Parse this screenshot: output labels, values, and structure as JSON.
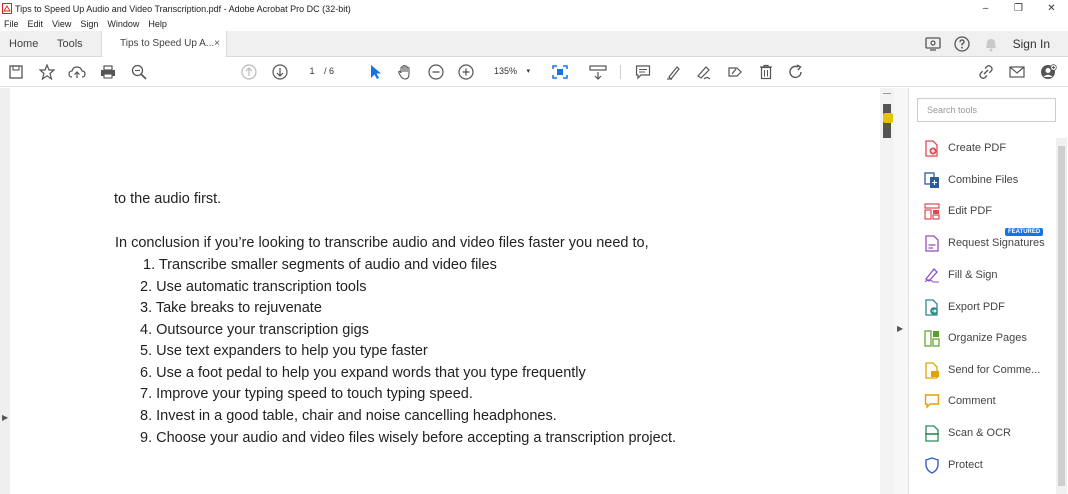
{
  "window": {
    "title": "Tips to Speed Up Audio and Video Transcription.pdf - Adobe Acrobat Pro DC (32-bit)",
    "minimize": "–",
    "maximize": "❐",
    "close": "✕"
  },
  "menu": [
    "File",
    "Edit",
    "View",
    "Sign",
    "Window",
    "Help"
  ],
  "tabs": {
    "home": "Home",
    "tools": "Tools",
    "doc": "Tips to Speed Up A...",
    "doc_close": "×"
  },
  "header": {
    "sign_in": "Sign In"
  },
  "toolbar": {
    "current_page": "1",
    "total_pages": "/ 6",
    "zoom": "135%",
    "zoom_caret": "▾"
  },
  "document": {
    "line1": "to the audio first.",
    "line2": "In conclusion if you’re looking to transcribe audio and video files faster you need to,",
    "list": [
      "1. Transcribe smaller segments of audio and video files",
      "2. Use automatic transcription tools",
      "3. Take breaks to rejuvenate",
      "4. Outsource your transcription gigs",
      "5. Use text expanders to help you type faster",
      "6. Use a foot pedal to help you expand words that you type frequently",
      "7. Improve your typing speed to touch typing speed.",
      "8. Invest in a good table, chair and noise cancelling headphones.",
      "9. Choose your audio and video files wisely before accepting a transcription project."
    ]
  },
  "tools_pane": {
    "search_placeholder": "Search tools",
    "featured": "FEATURED",
    "items": [
      {
        "label": "Create PDF",
        "icon": "create-pdf-icon",
        "color": "#e34850"
      },
      {
        "label": "Combine Files",
        "icon": "combine-files-icon",
        "color": "#2d5b9b"
      },
      {
        "label": "Edit PDF",
        "icon": "edit-pdf-icon",
        "color": "#e34850"
      },
      {
        "label": "Request Signatures",
        "icon": "request-signatures-icon",
        "color": "#9b4bc2"
      },
      {
        "label": "Fill & Sign",
        "icon": "fill-sign-icon",
        "color": "#8a4fc9"
      },
      {
        "label": "Export PDF",
        "icon": "export-pdf-icon",
        "color": "#2b8a8a"
      },
      {
        "label": "Organize Pages",
        "icon": "organize-pages-icon",
        "color": "#5b9e2e"
      },
      {
        "label": "Send for Comme...",
        "icon": "send-for-comment-icon",
        "color": "#e0a400"
      },
      {
        "label": "Comment",
        "icon": "comment-icon",
        "color": "#e0a400"
      },
      {
        "label": "Scan & OCR",
        "icon": "scan-ocr-icon",
        "color": "#2e8b57"
      },
      {
        "label": "Protect",
        "icon": "protect-icon",
        "color": "#3a5ec9"
      }
    ]
  },
  "colors": {
    "accent_blue": "#1473e6",
    "icon_gray": "#555555"
  }
}
